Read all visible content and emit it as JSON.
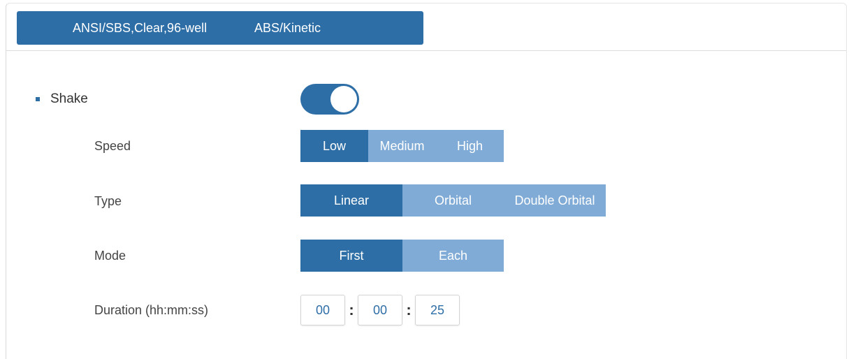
{
  "header": {
    "plate": "ANSI/SBS,Clear,96-well",
    "mode": "ABS/Kinetic"
  },
  "shake": {
    "title": "Shake",
    "enabled": true
  },
  "speed": {
    "label": "Speed",
    "options": [
      "Low",
      "Medium",
      "High"
    ],
    "selected": "Low"
  },
  "type": {
    "label": "Type",
    "options": [
      "Linear",
      "Orbital",
      "Double Orbital"
    ],
    "selected": "Linear"
  },
  "mode": {
    "label": "Mode",
    "options": [
      "First",
      "Each"
    ],
    "selected": "First"
  },
  "duration": {
    "label": "Duration (hh:mm:ss)",
    "hh": "00",
    "mm": "00",
    "ss": "25",
    "separator": ":"
  },
  "colors": {
    "primary": "#2e6ea6",
    "inactive": "#7fabd6"
  }
}
